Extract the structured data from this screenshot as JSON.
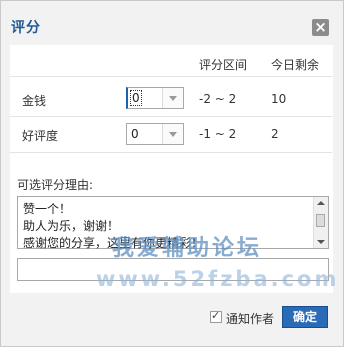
{
  "dialog": {
    "title": "评分",
    "close_glyph": "×"
  },
  "table": {
    "headers": {
      "range": "评分区间",
      "remaining": "今日剩余"
    },
    "rows": [
      {
        "label": "金钱",
        "value": "0",
        "range": "-2 ~ 2",
        "remaining": "10"
      },
      {
        "label": "好评度",
        "value": "0",
        "range": "-1 ~ 2",
        "remaining": "2"
      }
    ]
  },
  "reasons": {
    "label": "可选评分理由:",
    "options": [
      "赞一个！",
      "助人为乐，谢谢！",
      "感谢您的分享，这里有你更精彩！"
    ]
  },
  "watermark": {
    "line1": "我爱辅助论坛",
    "line2": "www.52fzba.com"
  },
  "footer": {
    "notify_label": "通知作者",
    "notify_checked": true,
    "confirm_label": "确定"
  },
  "colors": {
    "title": "#1f5a96",
    "button": "#2a6bb8"
  }
}
